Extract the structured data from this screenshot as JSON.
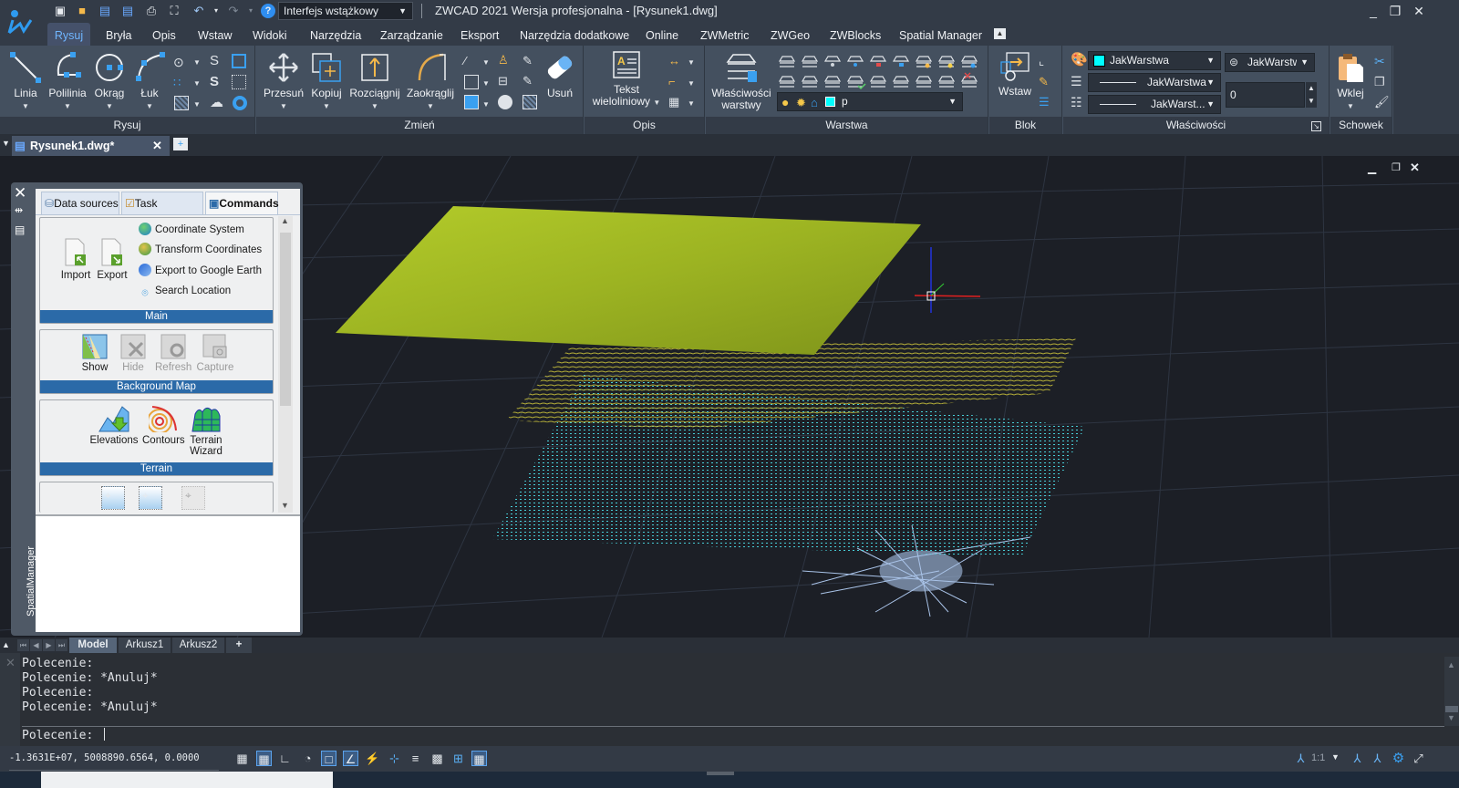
{
  "titlebar": {
    "workspace_select": "Interfejs wstążkowy",
    "app_title": "ZWCAD 2021 Wersja profesjonalna - [Rysunek1.dwg]",
    "quick_access": [
      "new-icon",
      "open-icon",
      "save-icon",
      "save-as-icon",
      "print-icon",
      "zoom-extents-icon",
      "undo-icon",
      "redo-icon",
      "help-icon"
    ]
  },
  "ribbon_tabs": [
    "Rysuj",
    "Bryła",
    "Opis",
    "Wstaw",
    "Widoki",
    "Narzędzia",
    "Zarządzanie",
    "Eksport",
    "Narzędzia dodatkowe",
    "Online",
    "ZWMetric",
    "ZWGeo",
    "ZWBlocks",
    "Spatial Manager"
  ],
  "ribbon_active_tab": "Rysuj",
  "ribbon": {
    "rysuj": {
      "label": "Rysuj",
      "buttons": [
        "Linia",
        "Polilinia",
        "Okrąg",
        "Łuk"
      ]
    },
    "zmien": {
      "label": "Zmień",
      "buttons": [
        "Przesuń",
        "Kopiuj",
        "Rozciągnij",
        "Zaokrąglij",
        "Usuń"
      ]
    },
    "opis": {
      "label": "Opis",
      "text_line1": "Tekst",
      "text_line2": "wieloliniowy"
    },
    "warstwa": {
      "label": "Warstwa",
      "props_line1": "Właściwości",
      "props_line2": "warstwy",
      "layer_current": "p",
      "layer_color": "#00ffff"
    },
    "blok": {
      "label": "Blok",
      "insert": "Wstaw"
    },
    "wlasciwosci": {
      "label": "Właściwości",
      "color": "JakWarstwa",
      "color_swatch": "#00ffff",
      "linetype": "JakWarstwa",
      "lineweight": "JakWarst...",
      "layer_style": "JakWarstw",
      "transparency": "0"
    },
    "schowek": {
      "label": "Schowek",
      "paste": "Wklej"
    }
  },
  "doc_tab": {
    "name": "Rysunek1.dwg*"
  },
  "palette": {
    "side_title": "SpatialManager",
    "tabs": [
      "Data sources",
      "Task manager",
      "Commands"
    ],
    "active_tab": "Commands",
    "main": {
      "label": "Main",
      "buttons": [
        "Import",
        "Export"
      ],
      "commands": [
        "Coordinate System",
        "Transform Coordinates",
        "Export to Google Earth",
        "Search Location"
      ]
    },
    "background_map": {
      "label": "Background Map",
      "buttons": [
        {
          "label": "Show",
          "enabled": true
        },
        {
          "label": "Hide",
          "enabled": false
        },
        {
          "label": "Refresh",
          "enabled": false
        },
        {
          "label": "Capture",
          "enabled": false
        }
      ]
    },
    "terrain": {
      "label": "Terrain",
      "buttons": [
        "Elevations",
        "Contours",
        "Terrain Wizard"
      ],
      "wizard_line1": "Terrain",
      "wizard_line2": "Wizard"
    }
  },
  "layout_tabs": [
    "Model",
    "Arkusz1",
    "Arkusz2",
    "+"
  ],
  "active_layout": "Model",
  "command_line": {
    "history": [
      "Polecenie:",
      "Polecenie: *Anuluj*",
      "Polecenie:",
      "Polecenie: *Anuluj*"
    ],
    "prompt": "Polecenie:"
  },
  "status": {
    "coords": "-1.3631E+07, 5008890.6564, 0.0000",
    "scale": "1:1"
  }
}
